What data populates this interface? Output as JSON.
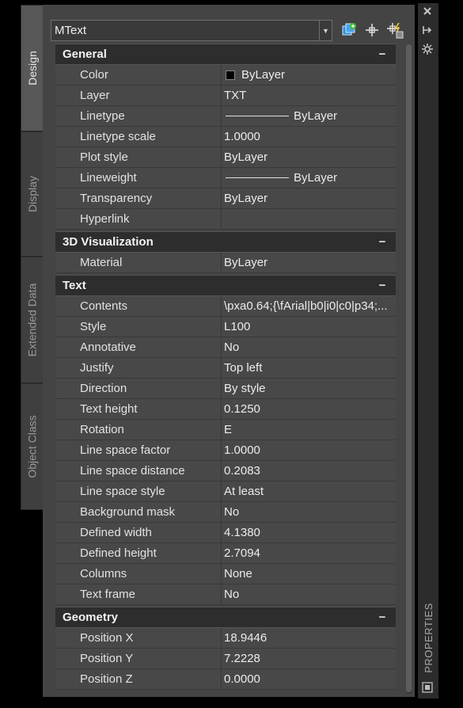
{
  "tabs": [
    {
      "label": "Design",
      "active": true
    },
    {
      "label": "Display",
      "active": false
    },
    {
      "label": "Extended Data",
      "active": false
    },
    {
      "label": "Object Class",
      "active": false
    }
  ],
  "object_selector": {
    "value": "MText"
  },
  "toolbar_icons": [
    "toggle-pickadd-icon",
    "select-objects-icon",
    "quick-select-icon"
  ],
  "right_strip": {
    "title": "PROPERTIES",
    "icons": [
      "close-icon",
      "auto-hide-icon",
      "properties-menu-icon"
    ]
  },
  "sections": [
    {
      "title": "General",
      "toggle": "−",
      "rows": [
        {
          "name": "Color",
          "value": "ByLayer",
          "kind": "color"
        },
        {
          "name": "Layer",
          "value": "TXT"
        },
        {
          "name": "Linetype",
          "value": "ByLayer",
          "kind": "line"
        },
        {
          "name": "Linetype scale",
          "value": "1.0000"
        },
        {
          "name": "Plot style",
          "value": "ByLayer"
        },
        {
          "name": "Lineweight",
          "value": "ByLayer",
          "kind": "line"
        },
        {
          "name": "Transparency",
          "value": "ByLayer"
        },
        {
          "name": "Hyperlink",
          "value": ""
        }
      ]
    },
    {
      "title": "3D Visualization",
      "toggle": "−",
      "rows": [
        {
          "name": "Material",
          "value": "ByLayer"
        }
      ]
    },
    {
      "title": "Text",
      "toggle": "−",
      "rows": [
        {
          "name": "Contents",
          "value": "\\pxa0.64;{\\fArial|b0|i0|c0|p34;..."
        },
        {
          "name": "Style",
          "value": "L100"
        },
        {
          "name": "Annotative",
          "value": "No"
        },
        {
          "name": "Justify",
          "value": "Top left"
        },
        {
          "name": "Direction",
          "value": "By style"
        },
        {
          "name": "Text height",
          "value": "0.1250"
        },
        {
          "name": "Rotation",
          "value": "E"
        },
        {
          "name": "Line space factor",
          "value": "1.0000"
        },
        {
          "name": "Line space distance",
          "value": "0.2083"
        },
        {
          "name": "Line space style",
          "value": "At least"
        },
        {
          "name": "Background mask",
          "value": "No"
        },
        {
          "name": "Defined width",
          "value": "4.1380"
        },
        {
          "name": "Defined height",
          "value": "2.7094"
        },
        {
          "name": "Columns",
          "value": "None"
        },
        {
          "name": "Text frame",
          "value": "No"
        }
      ]
    },
    {
      "title": "Geometry",
      "toggle": "−",
      "rows": [
        {
          "name": "Position X",
          "value": "18.9446"
        },
        {
          "name": "Position Y",
          "value": "7.2228"
        },
        {
          "name": "Position Z",
          "value": "0.0000"
        }
      ]
    }
  ]
}
